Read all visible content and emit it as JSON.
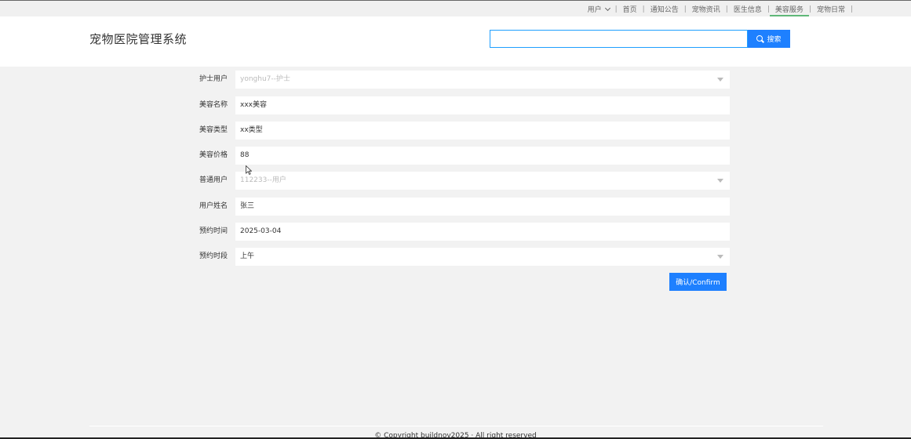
{
  "topnav": {
    "user_label": "用户",
    "items": [
      {
        "label": "首页"
      },
      {
        "label": "通知公告"
      },
      {
        "label": "宠物资讯"
      },
      {
        "label": "医生信息"
      },
      {
        "label": "美容服务"
      },
      {
        "label": "宠物日常"
      }
    ],
    "separator": "|",
    "active_color": "#5fb878"
  },
  "header": {
    "title": "宠物医院管理系统",
    "search_value": "",
    "search_button": "搜索",
    "accent": "#1e80ff"
  },
  "form": {
    "fields": [
      {
        "label": "护士用户",
        "value": "yonghu7--护士",
        "type": "select",
        "disabled": true
      },
      {
        "label": "美容名称",
        "value": "xxx美容",
        "type": "text"
      },
      {
        "label": "美容类型",
        "value": "xx类型",
        "type": "text"
      },
      {
        "label": "美容价格",
        "value": "88",
        "type": "text"
      },
      {
        "label": "普通用户",
        "value": "112233--用户",
        "type": "select",
        "disabled": true
      },
      {
        "label": "用户姓名",
        "value": "张三",
        "type": "text"
      },
      {
        "label": "预约时间",
        "value": "2025-03-04",
        "type": "text"
      },
      {
        "label": "预约时段",
        "value": "上午",
        "type": "select"
      }
    ],
    "confirm_button": "确认/Confirm"
  },
  "footer": {
    "text": "© Copyright buildnov2025 · All right reserved"
  }
}
